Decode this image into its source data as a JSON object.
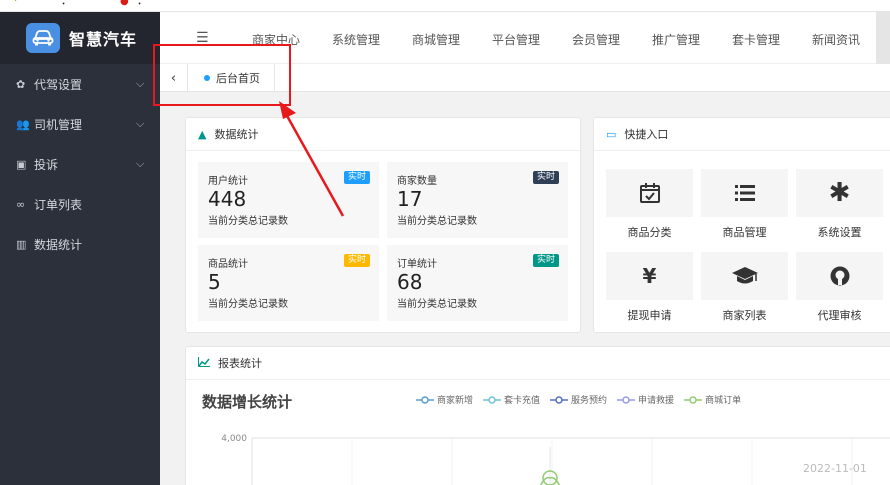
{
  "browser_fragments": [
    "·",
    "ꞏ",
    "●",
    "ꞏ"
  ],
  "app": {
    "brand": "智慧汽车"
  },
  "sidebar": {
    "items": [
      {
        "label": "代驾设置",
        "icon": "gear-icon",
        "expandable": true
      },
      {
        "label": "司机管理",
        "icon": "users-icon",
        "expandable": true
      },
      {
        "label": "投诉",
        "icon": "complaint-icon",
        "expandable": true
      },
      {
        "label": "订单列表",
        "icon": "bicycle-icon",
        "expandable": false
      },
      {
        "label": "数据统计",
        "icon": "bar-chart-icon",
        "expandable": false
      }
    ]
  },
  "topnav": {
    "items": [
      "商家中心",
      "系统管理",
      "商城管理",
      "平台管理",
      "会员管理",
      "推广管理",
      "套卡管理",
      "新闻资讯"
    ]
  },
  "tabs": {
    "active": "后台首页"
  },
  "stats": {
    "title": "数据统计",
    "cards": [
      {
        "title": "用户统计",
        "value": "448",
        "desc": "当前分类总记录数",
        "badge": "实时",
        "badge_color": "#1e9fff"
      },
      {
        "title": "商家数量",
        "value": "17",
        "desc": "当前分类总记录数",
        "badge": "实时",
        "badge_color": "#2f4056"
      },
      {
        "title": "商品统计",
        "value": "5",
        "desc": "当前分类总记录数",
        "badge": "实时",
        "badge_color": "#ffb800"
      },
      {
        "title": "订单统计",
        "value": "68",
        "desc": "当前分类总记录数",
        "badge": "实时",
        "badge_color": "#009688"
      }
    ]
  },
  "quick": {
    "title": "快捷入口",
    "items": [
      {
        "label": "商品分类",
        "icon": "calendar-check-icon"
      },
      {
        "label": "商品管理",
        "icon": "list-icon"
      },
      {
        "label": "系统设置",
        "icon": "asterisk-icon"
      },
      {
        "label": "提现申请",
        "icon": "yen-icon"
      },
      {
        "label": "商家列表",
        "icon": "graduation-cap-icon"
      },
      {
        "label": "代理审核",
        "icon": "github-icon"
      }
    ]
  },
  "report": {
    "title": "报表统计",
    "chart_data": {
      "type": "line",
      "title": "数据增长统计",
      "series": [
        {
          "name": "商家新增",
          "color": "#5b9bd5"
        },
        {
          "name": "套卡充值",
          "color": "#73c0de"
        },
        {
          "name": "服务预约",
          "color": "#5470c6"
        },
        {
          "name": "申请救援",
          "color": "#9a9ae6"
        },
        {
          "name": "商城订单",
          "color": "#91cc75"
        }
      ],
      "y_ticks": [
        "4,000"
      ],
      "ylim": [
        0,
        4000
      ],
      "tooltip_date": "2022-11-01"
    }
  },
  "colors": {
    "sidebar_bg": "#2b303b",
    "accent": "#1e9fff",
    "annotation": "#e8191c"
  }
}
